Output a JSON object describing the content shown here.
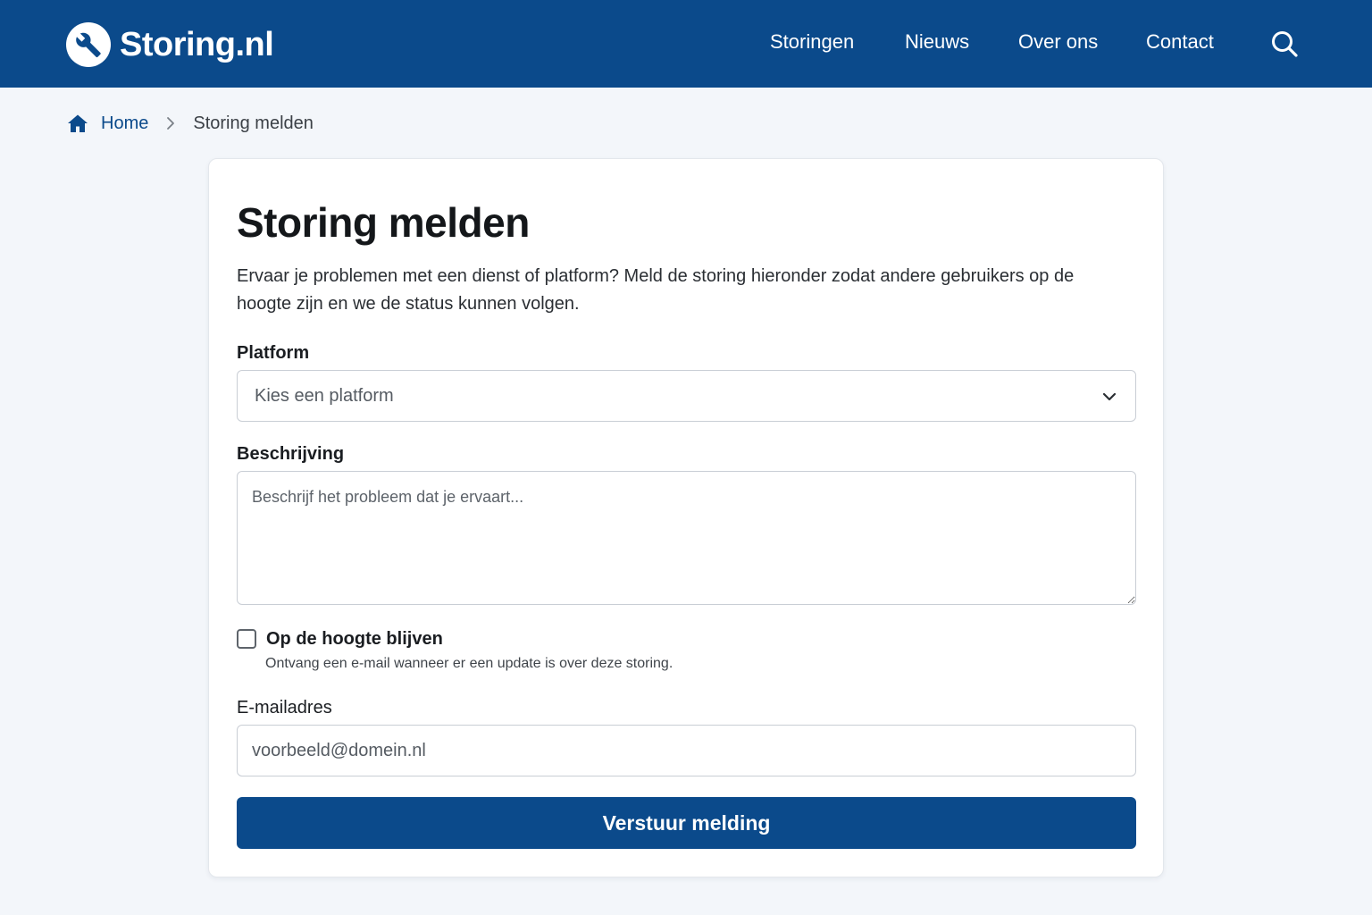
{
  "header": {
    "brand": "Storing.nl",
    "logo_icon": "wrench-icon",
    "nav": [
      {
        "label": "Storingen"
      },
      {
        "label": "Nieuws"
      },
      {
        "label": "Over ons"
      },
      {
        "label": "Contact"
      }
    ],
    "search_icon": "search-icon"
  },
  "breadcrumb": {
    "home_icon": "home-icon",
    "home": "Home",
    "separator_icon": "chevron-right-icon",
    "current": "Storing melden"
  },
  "form": {
    "title": "Storing melden",
    "intro": "Ervaar je problemen met een dienst of platform? Meld de storing hieronder zodat andere gebruikers op de hoogte zijn en we de status kunnen volgen.",
    "platform_label": "Platform",
    "platform_value": "Kies een platform",
    "description_label": "Beschrijving",
    "description_placeholder": "Beschrijf het probleem dat je ervaart...",
    "subscribe_label": "Op de hoogte blijven",
    "subscribe_help": "Ontvang een e-mail wanneer er een update is over deze storing.",
    "subscribe_checked": false,
    "email_label": "E-mailadres",
    "email_placeholder": "voorbeeld@domein.nl",
    "submit_label": "Verstuur melding"
  },
  "colors": {
    "brand": "#0b4a8b",
    "background": "#f3f6fa",
    "card": "#ffffff"
  }
}
